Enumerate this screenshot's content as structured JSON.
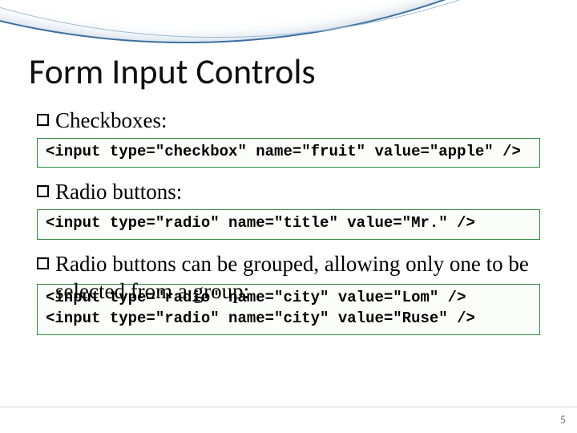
{
  "title": "Form Input Controls",
  "bullets": {
    "b1": "Checkboxes:",
    "b2": "Radio buttons:",
    "b3": "Radio buttons can be grouped, allowing only one to be selected from a group:"
  },
  "code": {
    "checkbox": "<input type=\"checkbox\" name=\"fruit\" value=\"apple\" />",
    "radio_single": "<input type=\"radio\" name=\"title\" value=\"Mr.\" />",
    "radio_group": "<input type=\"radio\" name=\"city\" value=\"Lom\" />\n<input type=\"radio\" name=\"city\" value=\"Ruse\" />"
  },
  "page_number": "5",
  "accent_border": "#2f8a3d"
}
